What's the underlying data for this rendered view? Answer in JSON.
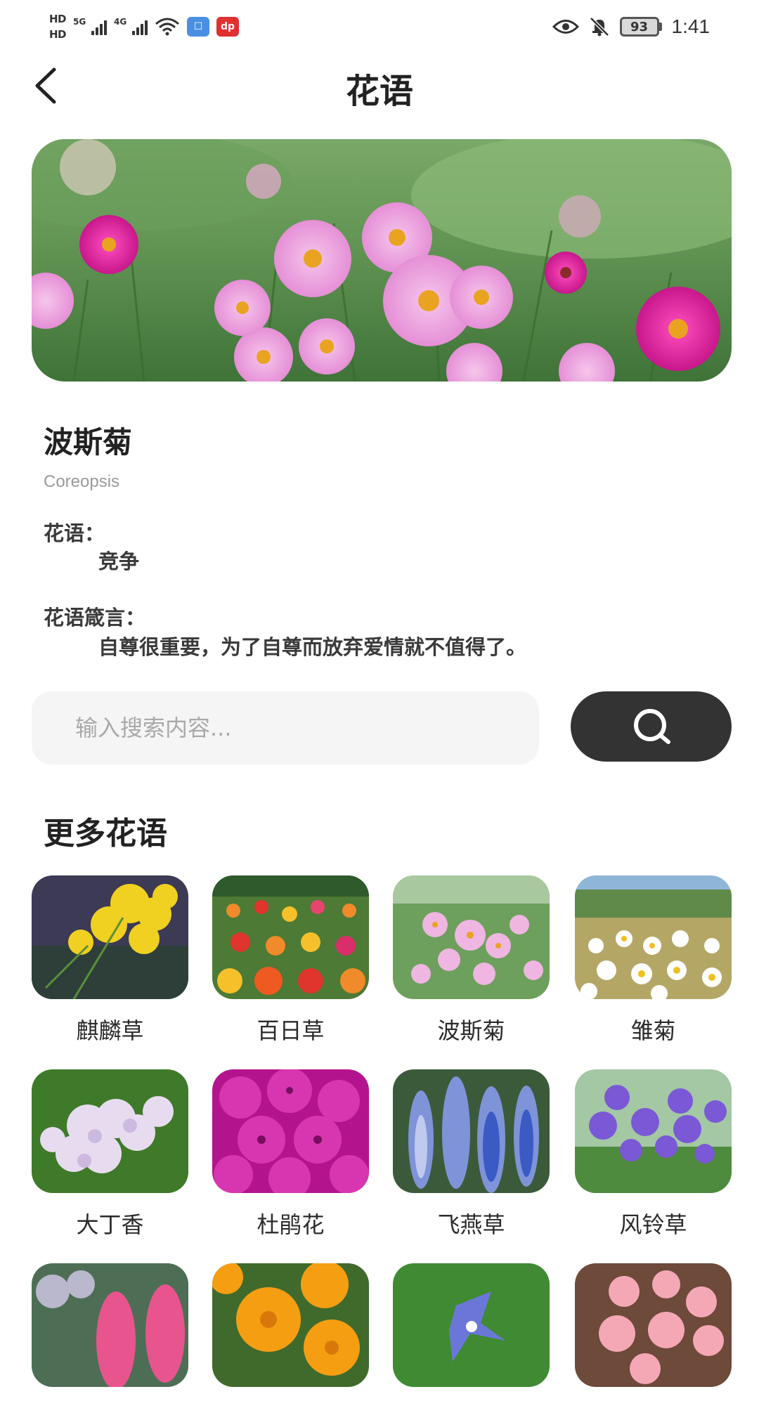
{
  "status_bar": {
    "hd1": "HD",
    "hd2": "HD",
    "net1": "5G",
    "net2": "4G",
    "battery": "93",
    "time": "1:41"
  },
  "header": {
    "title": "花语",
    "back_icon": "chevron-left-icon"
  },
  "flower": {
    "name": "波斯菊",
    "latin": "Coreopsis",
    "meaning_label": "花语：",
    "meaning": "竞争",
    "motto_label": "花语箴言：",
    "motto": "自尊很重要，为了自尊而放弃爱情就不值得了。"
  },
  "search": {
    "placeholder": "输入搜索内容...",
    "button_icon": "search-icon"
  },
  "more": {
    "title": "更多花语",
    "items": [
      {
        "name": "麒麟草"
      },
      {
        "name": "百日草"
      },
      {
        "name": "波斯菊"
      },
      {
        "name": "雏菊"
      },
      {
        "name": "大丁香"
      },
      {
        "name": "杜鹃花"
      },
      {
        "name": "飞燕草"
      },
      {
        "name": "风铃草"
      },
      {
        "name": ""
      },
      {
        "name": ""
      },
      {
        "name": ""
      },
      {
        "name": ""
      }
    ]
  },
  "colors": {
    "accent": "#333333",
    "search_bg": "#f5f5f5",
    "muted_text": "#9a9a9a"
  }
}
